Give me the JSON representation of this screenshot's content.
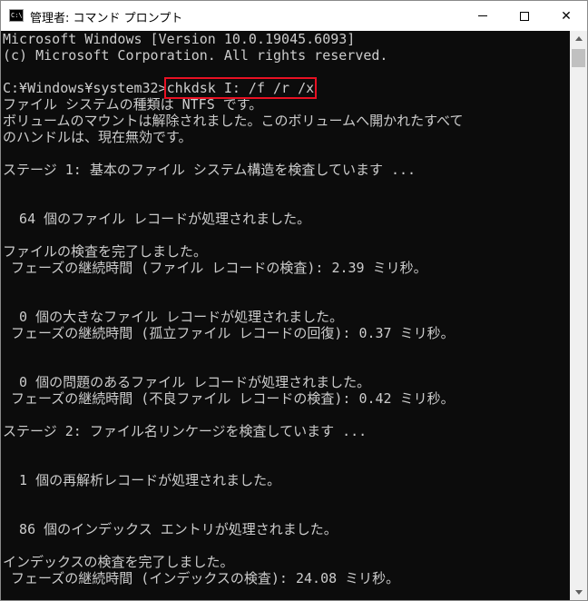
{
  "window": {
    "title": "管理者: コマンド プロンプト",
    "icon_text": "C:\\",
    "controls": {
      "minimize": "minimize-icon",
      "maximize": "maximize-icon",
      "close": "close-icon",
      "close_glyph": "✕"
    }
  },
  "console": {
    "lines": [
      {
        "text": "Microsoft Windows [Version 10.0.19045.6093]"
      },
      {
        "text": "(c) Microsoft Corporation. All rights reserved."
      },
      {
        "text": ""
      },
      {
        "prompt": "C:¥Windows¥system32>",
        "command": "chkdsk I: /f /r /x"
      },
      {
        "text": "ファイル システムの種類は NTFS です。"
      },
      {
        "text": "ボリュームのマウントは解除されました。このボリュームへ開かれたすべて"
      },
      {
        "text": "のハンドルは、現在無効です。"
      },
      {
        "text": ""
      },
      {
        "text": "ステージ 1: 基本のファイル システム構造を検査しています ..."
      },
      {
        "text": ""
      },
      {
        "text": ""
      },
      {
        "text": "  64 個のファイル レコードが処理されました。"
      },
      {
        "text": ""
      },
      {
        "text": "ファイルの検査を完了しました。"
      },
      {
        "text": " フェーズの継続時間 (ファイル レコードの検査): 2.39 ミリ秒。"
      },
      {
        "text": ""
      },
      {
        "text": ""
      },
      {
        "text": "  0 個の大きなファイル レコードが処理されました。"
      },
      {
        "text": " フェーズの継続時間 (孤立ファイル レコードの回復): 0.37 ミリ秒。"
      },
      {
        "text": ""
      },
      {
        "text": ""
      },
      {
        "text": "  0 個の問題のあるファイル レコードが処理されました。"
      },
      {
        "text": " フェーズの継続時間 (不良ファイル レコードの検査): 0.42 ミリ秒。"
      },
      {
        "text": ""
      },
      {
        "text": "ステージ 2: ファイル名リンケージを検査しています ..."
      },
      {
        "text": ""
      },
      {
        "text": ""
      },
      {
        "text": "  1 個の再解析レコードが処理されました。"
      },
      {
        "text": ""
      },
      {
        "text": ""
      },
      {
        "text": "  86 個のインデックス エントリが処理されました。"
      },
      {
        "text": ""
      },
      {
        "text": "インデックスの検査を完了しました。"
      },
      {
        "text": " フェーズの継続時間 (インデックスの検査): 24.08 ミリ秒。"
      }
    ]
  },
  "colors": {
    "console_bg": "#0c0c0c",
    "console_fg": "#cccccc",
    "highlight_box": "#e81123"
  }
}
